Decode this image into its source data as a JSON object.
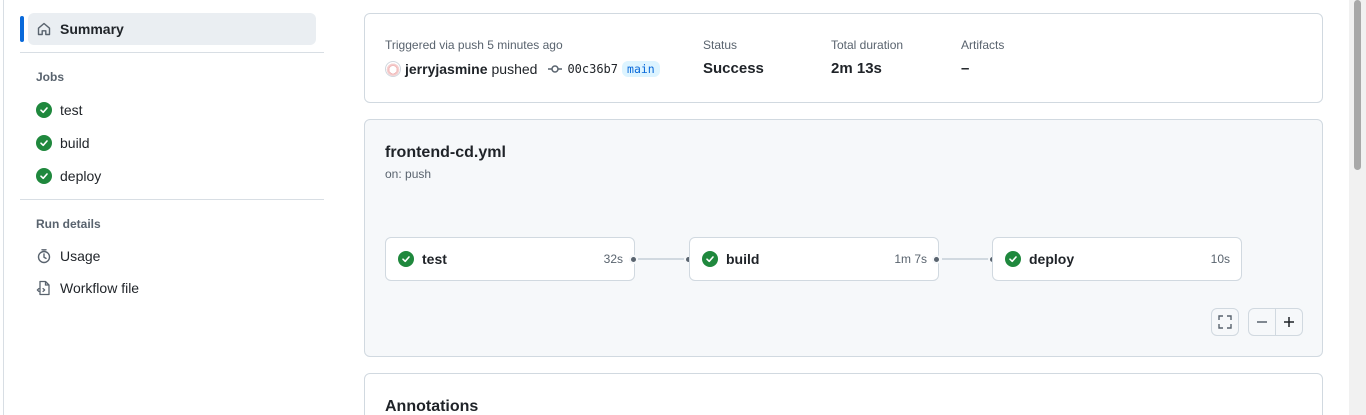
{
  "sidebar": {
    "summary_label": "Summary",
    "jobs_heading": "Jobs",
    "jobs": [
      {
        "label": "test"
      },
      {
        "label": "build"
      },
      {
        "label": "deploy"
      }
    ],
    "run_details_heading": "Run details",
    "details": [
      {
        "label": "Usage",
        "icon": "stopwatch-icon"
      },
      {
        "label": "Workflow file",
        "icon": "file-code-icon"
      }
    ]
  },
  "summary": {
    "trigger_text": "Triggered via push 5 minutes ago",
    "actor": "jerryjasmine",
    "action": "pushed",
    "commit_sha": "00c36b7",
    "branch": "main",
    "status_label": "Status",
    "status_value": "Success",
    "duration_label": "Total duration",
    "duration_value": "2m 13s",
    "artifacts_label": "Artifacts",
    "artifacts_value": "–"
  },
  "workflow": {
    "file_name": "frontend-cd.yml",
    "trigger": "on: push",
    "jobs": [
      {
        "name": "test",
        "duration": "32s"
      },
      {
        "name": "build",
        "duration": "1m 7s"
      },
      {
        "name": "deploy",
        "duration": "10s"
      }
    ]
  },
  "annotations": {
    "title": "Annotations"
  },
  "colors": {
    "success": "#1f883d",
    "accent": "#0969da"
  }
}
